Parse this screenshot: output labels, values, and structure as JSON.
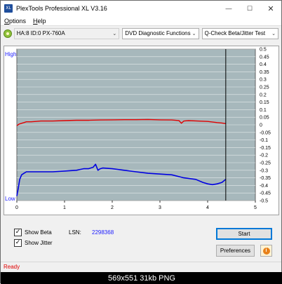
{
  "window": {
    "title": "PlexTools Professional XL V3.16",
    "app_icon_text": "XL",
    "controls": {
      "minimize": "—",
      "maximize": "☐",
      "close": "✕"
    }
  },
  "menu": {
    "options": "Options",
    "options_underline": "O",
    "options_rest": "ptions",
    "help": "Help",
    "help_underline": "H",
    "help_rest": "elp"
  },
  "toolbar": {
    "drive": "HA:8 ID:0  PX-760A",
    "mode": "DVD Diagnostic Functions",
    "test": "Q-Check Beta/Jitter Test",
    "chevron": "⌄"
  },
  "chart_data": {
    "type": "line",
    "title": "",
    "xlabel": "",
    "ylabel": "",
    "left_axis_labels": {
      "high": "High",
      "low": "Low"
    },
    "x_ticks": [
      0,
      1,
      2,
      3,
      4,
      5
    ],
    "xlim": [
      0,
      5
    ],
    "y_ticks": [
      0.5,
      0.45,
      0.4,
      0.35,
      0.3,
      0.25,
      0.2,
      0.15,
      0.1,
      0.05,
      0,
      -0.05,
      -0.1,
      -0.15,
      -0.2,
      -0.25,
      -0.3,
      -0.35,
      -0.4,
      -0.45,
      -0.5
    ],
    "ylim": [
      -0.5,
      0.5
    ],
    "grid": true,
    "end_marker_x": 4.38,
    "background": "#a7b8bc",
    "series": [
      {
        "color": "#e00000",
        "x": [
          0.0,
          0.05,
          0.1,
          0.15,
          0.2,
          0.3,
          0.4,
          0.5,
          0.75,
          1.0,
          1.25,
          1.5,
          1.75,
          2.0,
          2.25,
          2.5,
          2.75,
          3.0,
          3.25,
          3.4,
          3.45,
          3.5,
          3.6,
          3.75,
          4.0,
          4.2,
          4.3,
          4.38
        ],
        "y": [
          -0.005,
          0.005,
          0.01,
          0.015,
          0.02,
          0.02,
          0.022,
          0.025,
          0.025,
          0.028,
          0.03,
          0.03,
          0.032,
          0.033,
          0.034,
          0.034,
          0.035,
          0.033,
          0.032,
          0.028,
          0.01,
          0.025,
          0.028,
          0.026,
          0.022,
          0.015,
          0.012,
          0.008
        ]
      },
      {
        "color": "#0000e0",
        "x": [
          0.0,
          0.03,
          0.06,
          0.1,
          0.15,
          0.2,
          0.3,
          0.4,
          0.5,
          0.75,
          1.0,
          1.25,
          1.4,
          1.5,
          1.6,
          1.65,
          1.7,
          1.75,
          1.8,
          2.0,
          2.25,
          2.5,
          2.75,
          3.0,
          3.25,
          3.5,
          3.75,
          3.9,
          4.0,
          4.1,
          4.2,
          4.3,
          4.38
        ],
        "y": [
          -0.47,
          -0.42,
          -0.36,
          -0.33,
          -0.32,
          -0.31,
          -0.31,
          -0.31,
          -0.31,
          -0.31,
          -0.305,
          -0.3,
          -0.29,
          -0.29,
          -0.28,
          -0.26,
          -0.3,
          -0.29,
          -0.285,
          -0.29,
          -0.3,
          -0.31,
          -0.32,
          -0.325,
          -0.33,
          -0.35,
          -0.36,
          -0.38,
          -0.39,
          -0.395,
          -0.39,
          -0.38,
          -0.36
        ]
      }
    ]
  },
  "controls": {
    "show_beta": "Show Beta",
    "show_beta_checked": true,
    "show_jitter": "Show Jitter",
    "show_jitter_checked": true,
    "check_mark": "✓",
    "lsn_label": "LSN:",
    "lsn_value": "2298368",
    "start_button": "Start",
    "preferences_button": "Preferences",
    "info_button": "i"
  },
  "status": {
    "text": "Ready"
  },
  "caption": "569x551 31kb PNG"
}
